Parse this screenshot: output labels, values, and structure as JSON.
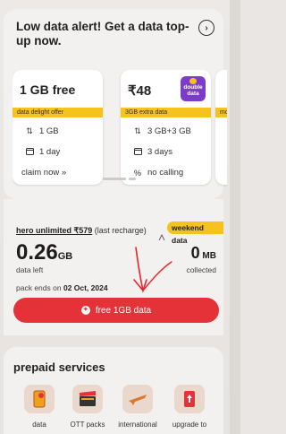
{
  "alert": {
    "title": "Low data alert! Get a data top-up now.",
    "arrow_glyph": "›"
  },
  "offers": [
    {
      "price": "1 GB free",
      "tag": "data delight offer",
      "line1": "1 GB",
      "line2": "1 day",
      "action": "claim now »"
    },
    {
      "price": "₹48",
      "tag": "3GB extra data",
      "line1": "3 GB+3 GB",
      "line2": "3 days",
      "line3": "no calling",
      "badge": "double data"
    },
    {
      "tag": "mo"
    }
  ],
  "balance": {
    "plan_name": "hero unlimited ₹579",
    "plan_suffix": " (last recharge)",
    "weekend_label": "weekend data",
    "data_left_value": "0.26",
    "data_left_unit": "GB",
    "data_left_label": "data left",
    "collected_value": "0",
    "collected_unit": " MB",
    "collected_label": "collected",
    "pack_ends_prefix": "pack ends on ",
    "pack_ends_date": "02 Oct, 2024",
    "button_label": "free 1GB data"
  },
  "services": {
    "title": "prepaid services",
    "items": [
      {
        "label": "data",
        "icon": "phone-data-icon"
      },
      {
        "label": "OTT packs",
        "icon": "clapperboard-icon"
      },
      {
        "label": "international",
        "icon": "airplane-icon"
      },
      {
        "label": "upgrade to",
        "icon": "upgrade-phone-icon"
      }
    ]
  },
  "colors": {
    "accent_red": "#e53238",
    "tag_yellow": "#f6c21c",
    "badge_purple": "#7c3bc9",
    "card_bg": "#f3f1ef"
  }
}
